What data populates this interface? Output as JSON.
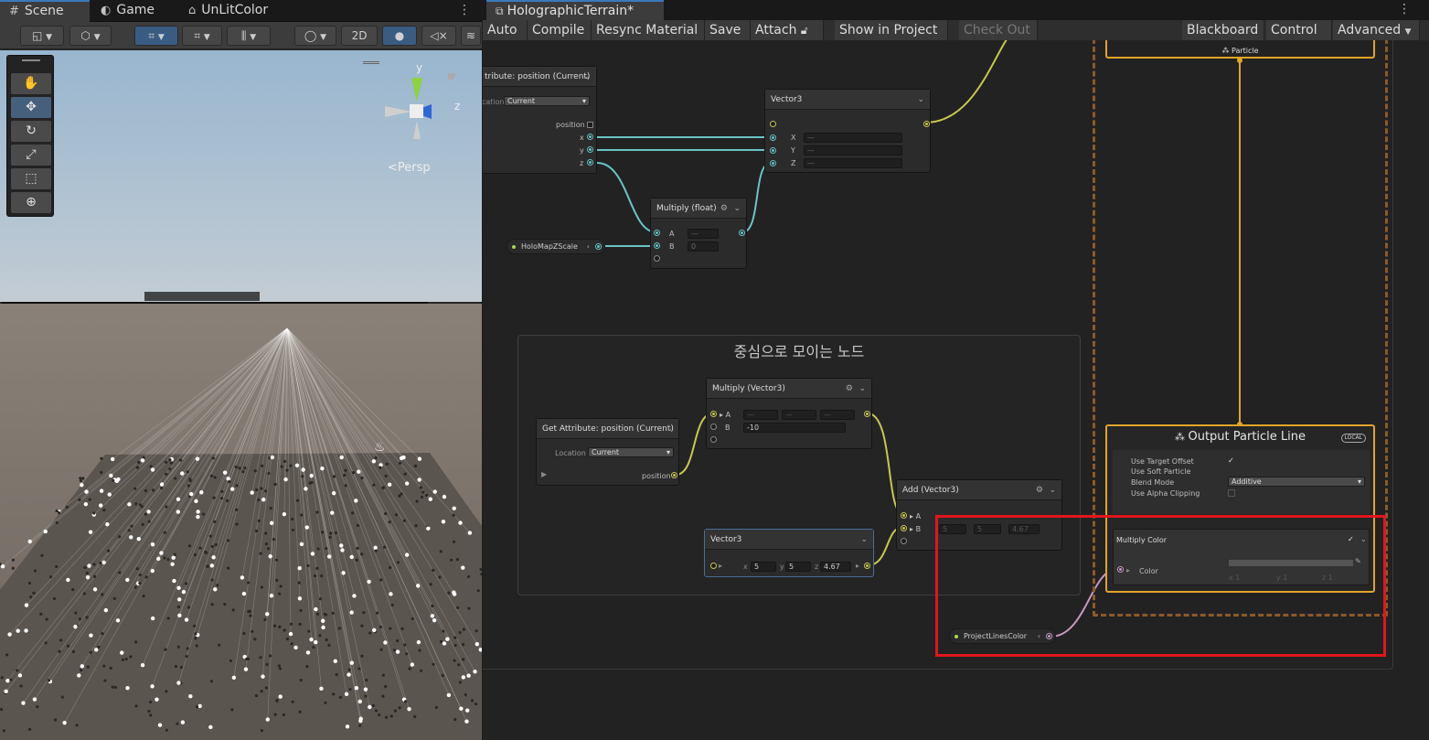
{
  "scene": {
    "tabs": [
      {
        "icon": "grid-icon",
        "label": "Scene"
      },
      {
        "icon": "gamepad-icon",
        "label": "Game"
      },
      {
        "icon": "robot-icon",
        "label": "UnLitColor"
      }
    ],
    "toolbar": {
      "two_d_label": "2D"
    },
    "gizmo": {
      "y_label": "y",
      "z_label": "z",
      "persp_label": "Persp"
    },
    "tools": [
      "hand-tool",
      "move-tool",
      "rotate-tool",
      "scale-tool",
      "rect-tool",
      "transform-tool"
    ]
  },
  "graph": {
    "tab_title": "HolographicTerrain*",
    "toolbar": {
      "auto": "Auto",
      "compile": "Compile",
      "resync": "Resync Material",
      "save": "Save",
      "attach": "Attach",
      "show_in_project": "Show in Project",
      "check_out": "Check Out",
      "blackboard": "Blackboard",
      "control": "Control",
      "advanced": "Advanced"
    },
    "group_title": "중심으로 모이는 노드",
    "nodes": {
      "get_attr_top": {
        "title": "tribute: position (Current)",
        "location_label": "cation",
        "location_value": "Current",
        "out_position": "position",
        "out_x": "x",
        "out_y": "y",
        "out_z": "z"
      },
      "vector3_top": {
        "title": "Vector3",
        "x": "X",
        "y": "Y",
        "z": "Z",
        "dash": "—"
      },
      "multiply_float": {
        "title": "Multiply (float)",
        "a": "A",
        "b": "B",
        "a_value": "—",
        "b_value": "0"
      },
      "holo_map": {
        "name": "HoloMapZScale"
      },
      "get_attr": {
        "title": "Get Attribute: position (Current)",
        "location_label": "Location",
        "location_value": "Current",
        "out_label": "position"
      },
      "multiply_vec3": {
        "title": "Multiply (Vector3)",
        "a": "A",
        "b": "B",
        "b_value": "-10",
        "x": "x",
        "y": "y",
        "z": "z"
      },
      "add_vec3": {
        "title": "Add (Vector3)",
        "a": "A",
        "b": "B",
        "b_x": "5",
        "b_y": "5",
        "b_z": "4.67"
      },
      "vector3_bottom": {
        "title": "Vector3",
        "x_label": "x",
        "x_value": "5",
        "y_label": "y",
        "y_value": "5",
        "z_label": "z",
        "z_value": "4.67"
      },
      "project_lines_color": {
        "name": "ProjectLinesColor"
      }
    },
    "particle_context": {
      "label": "Particle"
    },
    "output_context": {
      "title": "Output Particle Line",
      "badge": "LOCAL",
      "rows": [
        {
          "label": "Use Target Offset",
          "value": "✓"
        },
        {
          "label": "Use Soft Particle",
          "value": ""
        },
        {
          "label": "Blend Mode",
          "value": "Additive"
        },
        {
          "label": "Use Alpha Clipping",
          "value": ""
        }
      ],
      "block_title": "Multiply Color",
      "block_color_label": "Color",
      "block_color_sub": [
        "x 1",
        "y 1",
        "z 1"
      ]
    }
  }
}
